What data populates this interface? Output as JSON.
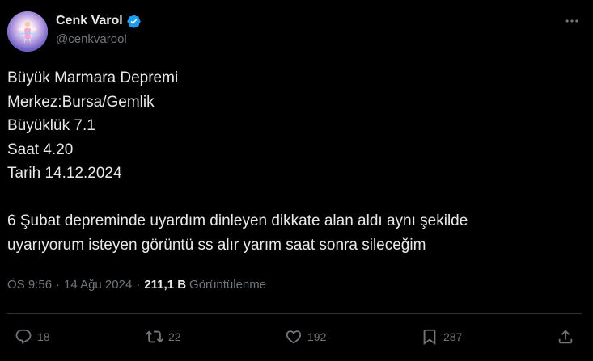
{
  "author": {
    "display_name": "Cenk Varol",
    "handle": "@cenkvarool",
    "verified": true,
    "verified_color": "#1d9bf0"
  },
  "tweet": {
    "lines": [
      "Büyük Marmara Depremi",
      "Merkez:Bursa/Gemlik",
      "Büyüklük 7.1",
      "Saat 4.20",
      "Tarih 14.12.2024"
    ],
    "paragraph_2_lines": [
      "6 Şubat depreminde uyardım dinleyen dikkate alan aldı aynı şekilde",
      "uyarıyorum isteyen görüntü ss alır yarım saat sonra sileceğim"
    ]
  },
  "meta": {
    "time": "ÖS 9:56",
    "separator": "·",
    "date": "14 Ağu 2024",
    "views_count": "211,1 B",
    "views_label": "Görüntülenme"
  },
  "actions": {
    "reply_count": "18",
    "retweet_count": "22",
    "like_count": "192",
    "bookmark_count": "287"
  },
  "icons": {
    "more": "more-horizontal-icon",
    "reply": "reply-icon",
    "retweet": "retweet-icon",
    "like": "heart-icon",
    "bookmark": "bookmark-icon",
    "share": "share-icon"
  },
  "colors": {
    "background": "#000000",
    "text": "#e7e9ea",
    "muted": "#71767b",
    "divider": "#2f3336"
  }
}
